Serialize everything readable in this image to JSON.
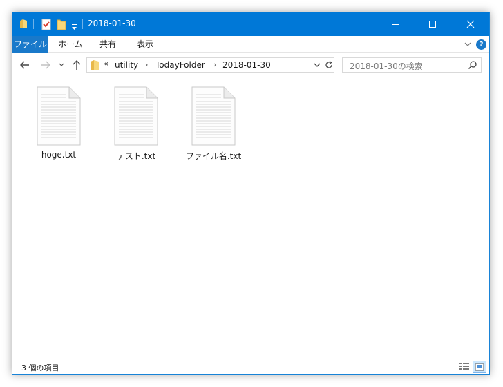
{
  "window": {
    "title": "2018-01-30"
  },
  "quick_access": {
    "icons": [
      "folder-icon",
      "properties-icon",
      "new-folder-icon",
      "customize-dropdown-icon"
    ]
  },
  "ribbon": {
    "tabs": [
      {
        "label": "ファイル",
        "active": true
      },
      {
        "label": "ホーム"
      },
      {
        "label": "共有"
      },
      {
        "label": "表示"
      }
    ],
    "help_label": "?"
  },
  "address": {
    "overflow": "«",
    "breadcrumbs": [
      "utility",
      "TodayFolder",
      "2018-01-30"
    ],
    "separator": "›"
  },
  "search": {
    "placeholder": "2018-01-30の検索"
  },
  "files": [
    {
      "name": "hoge.txt",
      "icon": "text-file-icon"
    },
    {
      "name": "テスト.txt",
      "icon": "text-file-icon"
    },
    {
      "name": "ファイル名.txt",
      "icon": "text-file-icon"
    }
  ],
  "status": {
    "item_count": "3 個の項目"
  },
  "colors": {
    "titlebar": "#0078d7",
    "file_tab": "#1979ca",
    "selected_view": "#cce8ff"
  }
}
